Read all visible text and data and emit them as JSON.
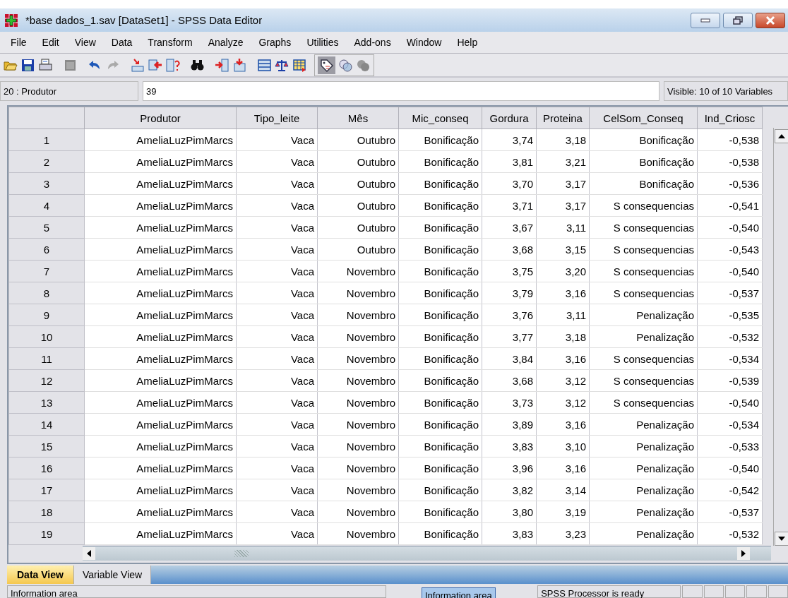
{
  "window": {
    "title": "*base dados_1.sav [DataSet1] - SPSS Data Editor"
  },
  "menu": [
    "File",
    "Edit",
    "View",
    "Data",
    "Transform",
    "Analyze",
    "Graphs",
    "Utilities",
    "Add-ons",
    "Window",
    "Help"
  ],
  "cell_editor": {
    "cell": "20 : Produtor",
    "value": "39",
    "visible": "Visible: 10 of 10 Variables"
  },
  "table": {
    "columns": [
      "Produtor",
      "Tipo_leite",
      "Mês",
      "Mic_conseq",
      "Gordura",
      "Proteina",
      "CelSom_Conseq",
      "Ind_Criosc"
    ],
    "rows": [
      {
        "n": "1",
        "cells": [
          "AmeliaLuzPimMarcs",
          "Vaca",
          "Outubro",
          "Bonificação",
          "3,74",
          "3,18",
          "Bonificação",
          "-0,538"
        ]
      },
      {
        "n": "2",
        "cells": [
          "AmeliaLuzPimMarcs",
          "Vaca",
          "Outubro",
          "Bonificação",
          "3,81",
          "3,21",
          "Bonificação",
          "-0,538"
        ]
      },
      {
        "n": "3",
        "cells": [
          "AmeliaLuzPimMarcs",
          "Vaca",
          "Outubro",
          "Bonificação",
          "3,70",
          "3,17",
          "Bonificação",
          "-0,536"
        ]
      },
      {
        "n": "4",
        "cells": [
          "AmeliaLuzPimMarcs",
          "Vaca",
          "Outubro",
          "Bonificação",
          "3,71",
          "3,17",
          "S consequencias",
          "-0,541"
        ]
      },
      {
        "n": "5",
        "cells": [
          "AmeliaLuzPimMarcs",
          "Vaca",
          "Outubro",
          "Bonificação",
          "3,67",
          "3,11",
          "S consequencias",
          "-0,540"
        ]
      },
      {
        "n": "6",
        "cells": [
          "AmeliaLuzPimMarcs",
          "Vaca",
          "Outubro",
          "Bonificação",
          "3,68",
          "3,15",
          "S consequencias",
          "-0,543"
        ]
      },
      {
        "n": "7",
        "cells": [
          "AmeliaLuzPimMarcs",
          "Vaca",
          "Novembro",
          "Bonificação",
          "3,75",
          "3,20",
          "S consequencias",
          "-0,540"
        ]
      },
      {
        "n": "8",
        "cells": [
          "AmeliaLuzPimMarcs",
          "Vaca",
          "Novembro",
          "Bonificação",
          "3,79",
          "3,16",
          "S consequencias",
          "-0,537"
        ]
      },
      {
        "n": "9",
        "cells": [
          "AmeliaLuzPimMarcs",
          "Vaca",
          "Novembro",
          "Bonificação",
          "3,76",
          "3,11",
          "Penalização",
          "-0,535"
        ]
      },
      {
        "n": "10",
        "cells": [
          "AmeliaLuzPimMarcs",
          "Vaca",
          "Novembro",
          "Bonificação",
          "3,77",
          "3,18",
          "Penalização",
          "-0,532"
        ]
      },
      {
        "n": "11",
        "cells": [
          "AmeliaLuzPimMarcs",
          "Vaca",
          "Novembro",
          "Bonificação",
          "3,84",
          "3,16",
          "S consequencias",
          "-0,534"
        ]
      },
      {
        "n": "12",
        "cells": [
          "AmeliaLuzPimMarcs",
          "Vaca",
          "Novembro",
          "Bonificação",
          "3,68",
          "3,12",
          "S consequencias",
          "-0,539"
        ]
      },
      {
        "n": "13",
        "cells": [
          "AmeliaLuzPimMarcs",
          "Vaca",
          "Novembro",
          "Bonificação",
          "3,73",
          "3,12",
          "S consequencias",
          "-0,540"
        ]
      },
      {
        "n": "14",
        "cells": [
          "AmeliaLuzPimMarcs",
          "Vaca",
          "Novembro",
          "Bonificação",
          "3,89",
          "3,16",
          "Penalização",
          "-0,534"
        ]
      },
      {
        "n": "15",
        "cells": [
          "AmeliaLuzPimMarcs",
          "Vaca",
          "Novembro",
          "Bonificação",
          "3,83",
          "3,10",
          "Penalização",
          "-0,533"
        ]
      },
      {
        "n": "16",
        "cells": [
          "AmeliaLuzPimMarcs",
          "Vaca",
          "Novembro",
          "Bonificação",
          "3,96",
          "3,16",
          "Penalização",
          "-0,540"
        ]
      },
      {
        "n": "17",
        "cells": [
          "AmeliaLuzPimMarcs",
          "Vaca",
          "Novembro",
          "Bonificação",
          "3,82",
          "3,14",
          "Penalização",
          "-0,542"
        ]
      },
      {
        "n": "18",
        "cells": [
          "AmeliaLuzPimMarcs",
          "Vaca",
          "Novembro",
          "Bonificação",
          "3,80",
          "3,19",
          "Penalização",
          "-0,537"
        ]
      },
      {
        "n": "19",
        "cells": [
          "AmeliaLuzPimMarcs",
          "Vaca",
          "Novembro",
          "Bonificação",
          "3,83",
          "3,23",
          "Penalização",
          "-0,532"
        ]
      }
    ]
  },
  "tabs": [
    {
      "label": "Data View",
      "selected": true
    },
    {
      "label": "Variable View",
      "selected": false
    }
  ],
  "status_bar": {
    "info": "Information area",
    "tooltip": "Information area",
    "processor": "SPSS  Processor is ready"
  }
}
